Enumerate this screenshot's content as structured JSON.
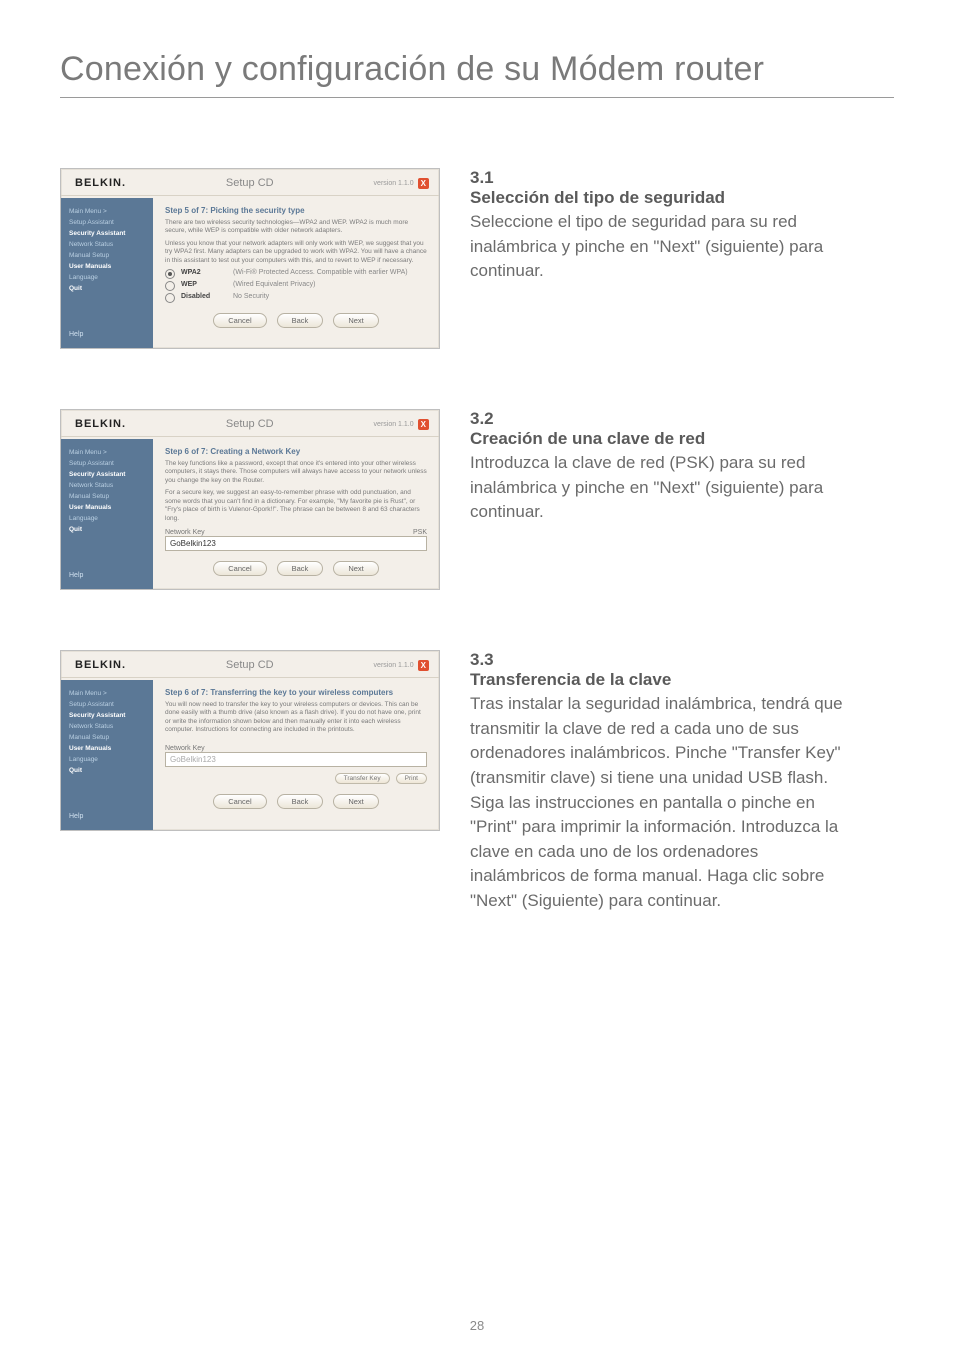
{
  "page_title": "Conexión y configuración de su Módem router",
  "page_number": "28",
  "sections": [
    {
      "num": "3.1",
      "heading": "Selección del tipo de seguridad",
      "body": "Seleccione el tipo de seguridad para su red inalámbrica y pinche en \"Next\" (siguiente) para continuar."
    },
    {
      "num": "3.2",
      "heading": "Creación de una clave de red",
      "body": "Introduzca la clave de red (PSK) para su red inalámbrica y pinche en \"Next\" (siguiente) para continuar."
    },
    {
      "num": "3.3",
      "heading": "Transferencia de la clave",
      "body": "Tras instalar la seguridad inalámbrica, tendrá que transmitir la clave de red a cada uno de sus ordenadores inalámbricos. Pinche \"Transfer Key\" (transmitir clave) si tiene una unidad USB flash. Siga las instrucciones en pantalla o pinche en \"Print\" para imprimir la información. Introduzca la clave en cada uno de los ordenadores inalámbricos de forma manual. Haga clic sobre \"Next\" (Siguiente) para continuar."
    }
  ],
  "common": {
    "brand": "BELKIN.",
    "title": "Setup CD",
    "version": "version 1.1.0",
    "close": "X",
    "buttons": {
      "cancel": "Cancel",
      "back": "Back",
      "next": "Next"
    },
    "side_bottom": {
      "help": "Help"
    },
    "side_items": [
      "Main Menu  >",
      "Setup Assistant",
      "Security Assistant",
      "Network Status",
      "Manual Setup",
      "User Manuals",
      "Language",
      "Quit"
    ]
  },
  "shot1": {
    "step": "Step 5 of 7: Picking the security type",
    "p1": "There are two wireless security technologies—WPA2 and WEP. WPA2 is much more secure, while WEP is compatible with older network adapters.",
    "p2": "Unless you know that your network adapters will only work with WEP, we suggest that you try WPA2 first. Many adapters can be upgraded to work with WPA2. You will have a chance in this assistant to test out your computers with this, and to revert to WEP if necessary.",
    "opts": [
      {
        "label": "WPA2",
        "desc": "(Wi-Fi® Protected Access. Compatible with earlier WPA)"
      },
      {
        "label": "WEP",
        "desc": "(Wired Equivalent Privacy)"
      },
      {
        "label": "Disabled",
        "desc": "No Security"
      }
    ]
  },
  "shot2": {
    "step": "Step 6 of 7: Creating a Network Key",
    "p1": "The key functions like a password, except that once it's entered into your other wireless computers, it stays there. Those computers will always have access to your network unless you change the key on the Router.",
    "p2": "For a secure key, we suggest an easy-to-remember phrase with odd punctuation, and some words that you can't find in a dictionary. For example, \"My favorite pie is Rust\", or \"Fry's place of birth is Vulenor-Gpork!!\". The phrase can be between 8 and 63 characters long.",
    "field_label": "Network Key",
    "field_right": "PSK",
    "value": "GoBelkin123"
  },
  "shot3": {
    "step": "Step 6 of 7: Transferring the key to your wireless computers",
    "p1": "You will now need to transfer the key to your wireless computers or devices. This can be done easily with a thumb drive (also known as a flash drive). If you do not have one, print or write the information shown below and then manually enter it into each wireless computer. Instructions for connecting are included in the printouts.",
    "field_label": "Network Key",
    "value": "GoBelkin123",
    "small_buttons": {
      "transfer": "Transfer Key",
      "print": "Print"
    }
  }
}
